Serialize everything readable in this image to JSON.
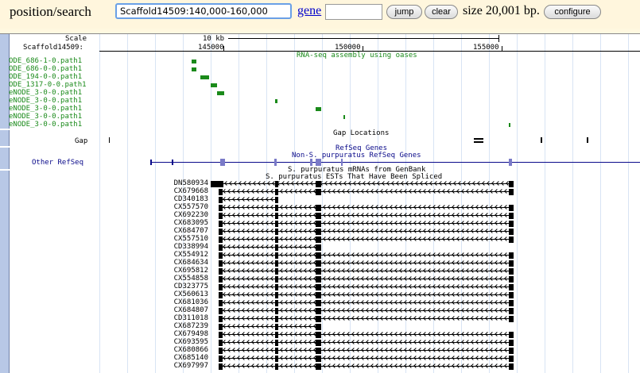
{
  "search": {
    "label": "position/search",
    "value": "Scaffold14509:140,000-160,000",
    "gene_link": "gene",
    "gene_value": "",
    "jump_label": "jump",
    "clear_label": "clear",
    "size_text": "size 20,001 bp.",
    "configure_label": "configure"
  },
  "ruler": {
    "scale_label": "Scale",
    "scale_value": "10 kb",
    "chrom_label": "Scaffold14509:",
    "ticks": [
      "145000",
      "150000",
      "155000"
    ]
  },
  "tracks": {
    "rnaseq_title": "RNA-seq assembly using oases",
    "rnaseq_items": [
      "ODE_686-1-0.path1",
      "ODE_686-0-0.path1",
      "ODE_194-0-0.path1",
      "ODE_1317-0-0.path1",
      "eNODE_3-0-0.path1",
      "eNODE_3-0-0.path1",
      "eNODE_3-0-0.path1",
      "eNODE_3-0-0.path1",
      "eNODE_3-0-0.path1"
    ],
    "gap_title": "Gap Locations",
    "gap_label": "Gap",
    "refseq_title": "RefSeq Genes",
    "other_refseq_title": "Non-S. purpuratus RefSeq Genes",
    "other_refseq_label": "Other RefSeq",
    "mrna_title": "S. purpuratus mRNAs from GenBank",
    "est_title": "S. purpuratus ESTs That Have Been Spliced",
    "est_items": [
      "DN580934",
      "CX679668",
      "CD340183",
      "CX557570",
      "CX692230",
      "CX683095",
      "CX684707",
      "CX557510",
      "CD338994",
      "CX554912",
      "CX684634",
      "CX695812",
      "CX554858",
      "CD323775",
      "CX560613",
      "CX681036",
      "CX684807",
      "CD311018",
      "CX687239",
      "CX679498",
      "CX693595",
      "CX680866",
      "CX685140",
      "CX697997"
    ]
  },
  "colors": {
    "rnaseq": "#1a8a1a",
    "est": "#000000",
    "refseq": "#0a0a8a",
    "link": "#0000cc"
  }
}
